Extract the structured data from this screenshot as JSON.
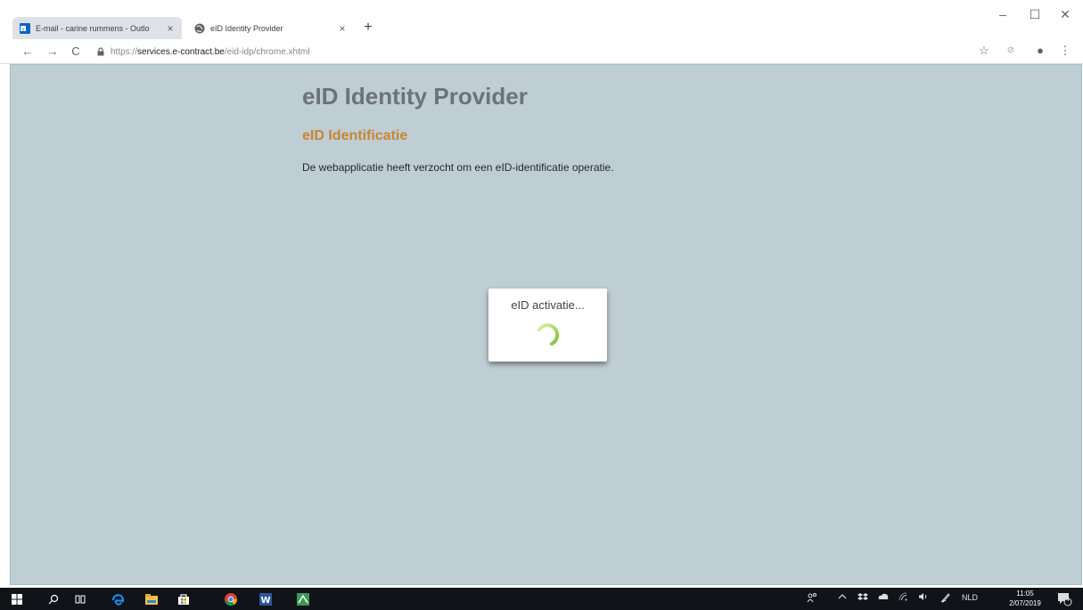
{
  "browser": {
    "tabs": [
      {
        "title": "E-mail - carine rummens - Outlo",
        "icon": "outlook-icon",
        "close": "×"
      },
      {
        "title": "eID Identity Provider",
        "icon": "globe-icon",
        "close": "×"
      }
    ],
    "new_tab": "+",
    "window_controls": {
      "minimize": "–",
      "maximize": "☐",
      "close": "✕"
    },
    "nav": {
      "back": "←",
      "forward": "→",
      "reload": "C"
    },
    "address": {
      "scheme": "https://",
      "host": "services.e-contract.be",
      "path": "/eid-idp/chrome.xhtml"
    },
    "toolbar_icons": {
      "bookmark": "☆",
      "extension": "⊘",
      "profile": "●",
      "menu": "⋮"
    }
  },
  "page": {
    "title": "eID Identity Provider",
    "subtitle": "eID Identificatie",
    "message": "De webapplicatie heeft verzocht om een eID-identificatie operatie.",
    "dialog": {
      "text": "eID activatie..."
    }
  },
  "taskbar": {
    "language": "NLD",
    "time": "11:05",
    "date": "2/07/2019",
    "notification_count": "4"
  },
  "colors": {
    "page_bg": "#bfcdd4",
    "title": "#6b7477",
    "subtitle": "#c98532",
    "spinner": "#8bc34a"
  }
}
